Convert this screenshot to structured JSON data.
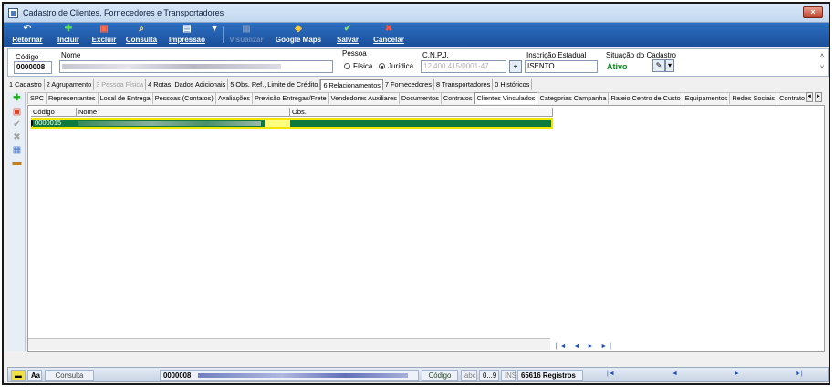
{
  "window": {
    "title": "Cadastro de Clientes, Fornecedores e Transportadores",
    "close_label": "×"
  },
  "toolbar": {
    "buttons": [
      {
        "label": "Retornar",
        "icon": "↶"
      },
      {
        "label": "Incluir",
        "icon": "✚"
      },
      {
        "label": "Excluir",
        "icon": "▣"
      },
      {
        "label": "Consulta",
        "icon": "⌕"
      },
      {
        "label": "Impressão",
        "icon": "▤"
      },
      {
        "label": "Visualizar",
        "icon": "▦"
      },
      {
        "label": "Google Maps",
        "icon": "◈"
      },
      {
        "label": "Salvar",
        "icon": "✔"
      },
      {
        "label": "Cancelar",
        "icon": "✖"
      }
    ],
    "dropdown_arrow": "▾"
  },
  "header": {
    "codigo_label": "Código",
    "codigo_value": "0000008",
    "nome_label": "Nome",
    "pessoa_label": "Pessoa",
    "pessoa_options": [
      "Física",
      "Jurídica"
    ],
    "pessoa_selected": "Jurídica",
    "cnpj_label": "C.N.P.J.",
    "cnpj_value": "12.400.415/0001-47",
    "ie_label": "Inscrição Estadual",
    "ie_value": "ISENTO",
    "situacao_label": "Situação do Cadastro",
    "situacao_value": "Ativo"
  },
  "main_tabs": [
    {
      "label": "1 Cadastro",
      "state": "normal"
    },
    {
      "label": "2 Agrupamento",
      "state": "normal"
    },
    {
      "label": "3 Pessoa Física",
      "state": "disabled"
    },
    {
      "label": "4 Rotas, Dados Adicionais",
      "state": "normal"
    },
    {
      "label": "5 Obs. Ref., Limite de Crédito",
      "state": "normal"
    },
    {
      "label": "6 Relacionamentos",
      "state": "selected"
    },
    {
      "label": "7 Fornecedores",
      "state": "normal"
    },
    {
      "label": "8 Transportadores",
      "state": "normal"
    },
    {
      "label": "0 Históricos",
      "state": "normal"
    }
  ],
  "sub_tabs": [
    {
      "label": "SPC",
      "selected": false
    },
    {
      "label": "Representantes",
      "selected": false
    },
    {
      "label": "Local de Entrega",
      "selected": false
    },
    {
      "label": "Pessoas (Contatos)",
      "selected": false
    },
    {
      "label": "Avaliações",
      "selected": false
    },
    {
      "label": "Previsão Entregas/Frete",
      "selected": false
    },
    {
      "label": "Vendedores Auxiliares",
      "selected": false
    },
    {
      "label": "Documentos",
      "selected": false
    },
    {
      "label": "Contratos",
      "selected": false
    },
    {
      "label": "Clientes Vinculados",
      "selected": true
    },
    {
      "label": "Categorias Campanha",
      "selected": false
    },
    {
      "label": "Rateio Centro de Custo",
      "selected": false
    },
    {
      "label": "Equipamentos",
      "selected": false
    },
    {
      "label": "Redes Sociais",
      "selected": false
    },
    {
      "label": "Contrato - B",
      "selected": false
    }
  ],
  "grid": {
    "columns": [
      "Código",
      "Nome",
      "Obs."
    ],
    "rows": [
      {
        "codigo": "0000015",
        "nome": "",
        "obs": ""
      }
    ],
    "nav": "|◄ ◄ ► ►|"
  },
  "statusbar": {
    "aa": "Aa",
    "mode": "Consulta",
    "record_code": "0000008",
    "sort_field": "Código",
    "abc": "abc",
    "range": "0...9",
    "ins": "INS",
    "count": "65616 Registros",
    "nav_first": "|◄",
    "nav_prev": "◄",
    "nav_next": "►",
    "nav_last": "►|"
  },
  "colors": {
    "toolbar": "#1b4f9a",
    "selected_row": "#0e7a3e",
    "highlight": "#f2e600",
    "ativo": "#0a8a1a"
  }
}
